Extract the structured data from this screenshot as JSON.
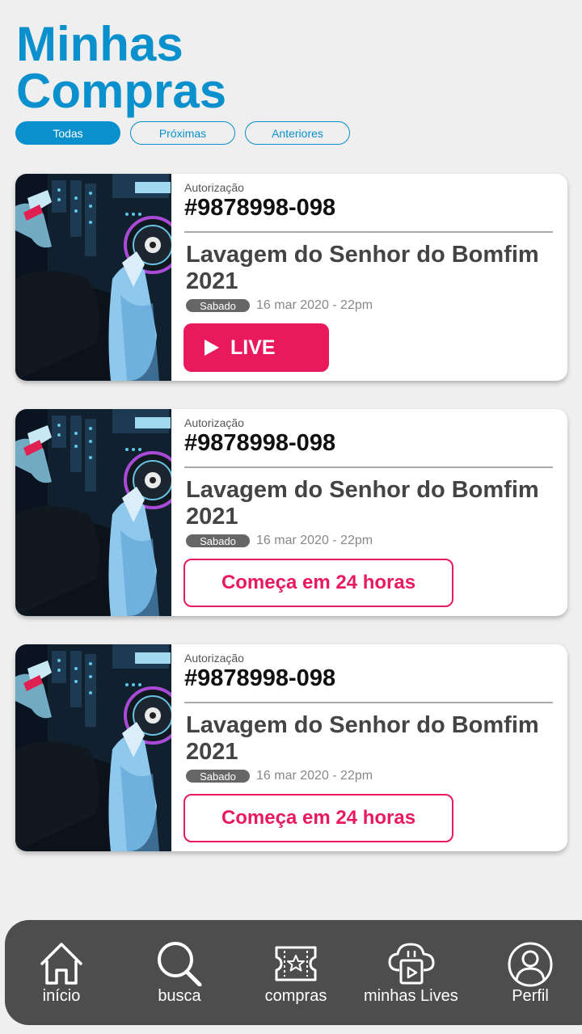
{
  "header": {
    "title_line1": "Minhas",
    "title_line2": "Compras"
  },
  "filters": {
    "tabs": [
      "Todas",
      "Próximas",
      "Anteriores"
    ],
    "active": "Todas"
  },
  "colors": {
    "accent": "#0a90cc",
    "pink": "#e8195c",
    "nav_bg": "#4d4d4d"
  },
  "purchases": [
    {
      "auth_label": "Autorização",
      "auth_number": "#9878998-098",
      "title": "Lavagem do Senhor do Bomfim 2021",
      "day": "Sabado",
      "date": "16 mar 2020 - 22pm",
      "action": {
        "type": "live",
        "label": "LIVE",
        "icon": "play-icon"
      }
    },
    {
      "auth_label": "Autorização",
      "auth_number": "#9878998-098",
      "title": "Lavagem do Senhor do Bomfim 2021",
      "day": "Sabado",
      "date": "16 mar 2020 - 22pm",
      "action": {
        "type": "starts",
        "label": "Começa em 24 horas"
      }
    },
    {
      "auth_label": "Autorização",
      "auth_number": "#9878998-098",
      "title": "Lavagem do Senhor do Bomfim 2021",
      "day": "Sabado",
      "date": "16 mar 2020 - 22pm",
      "action": {
        "type": "starts",
        "label": "Começa em 24 horas"
      }
    }
  ],
  "nav": {
    "items": [
      {
        "label": "início",
        "icon": "home-icon"
      },
      {
        "label": "busca",
        "icon": "search-icon"
      },
      {
        "label": "compras",
        "icon": "ticket-icon"
      },
      {
        "label": "minhas Lives",
        "icon": "live-cloud-icon"
      },
      {
        "label": "Perfil",
        "icon": "profile-icon"
      }
    ]
  }
}
